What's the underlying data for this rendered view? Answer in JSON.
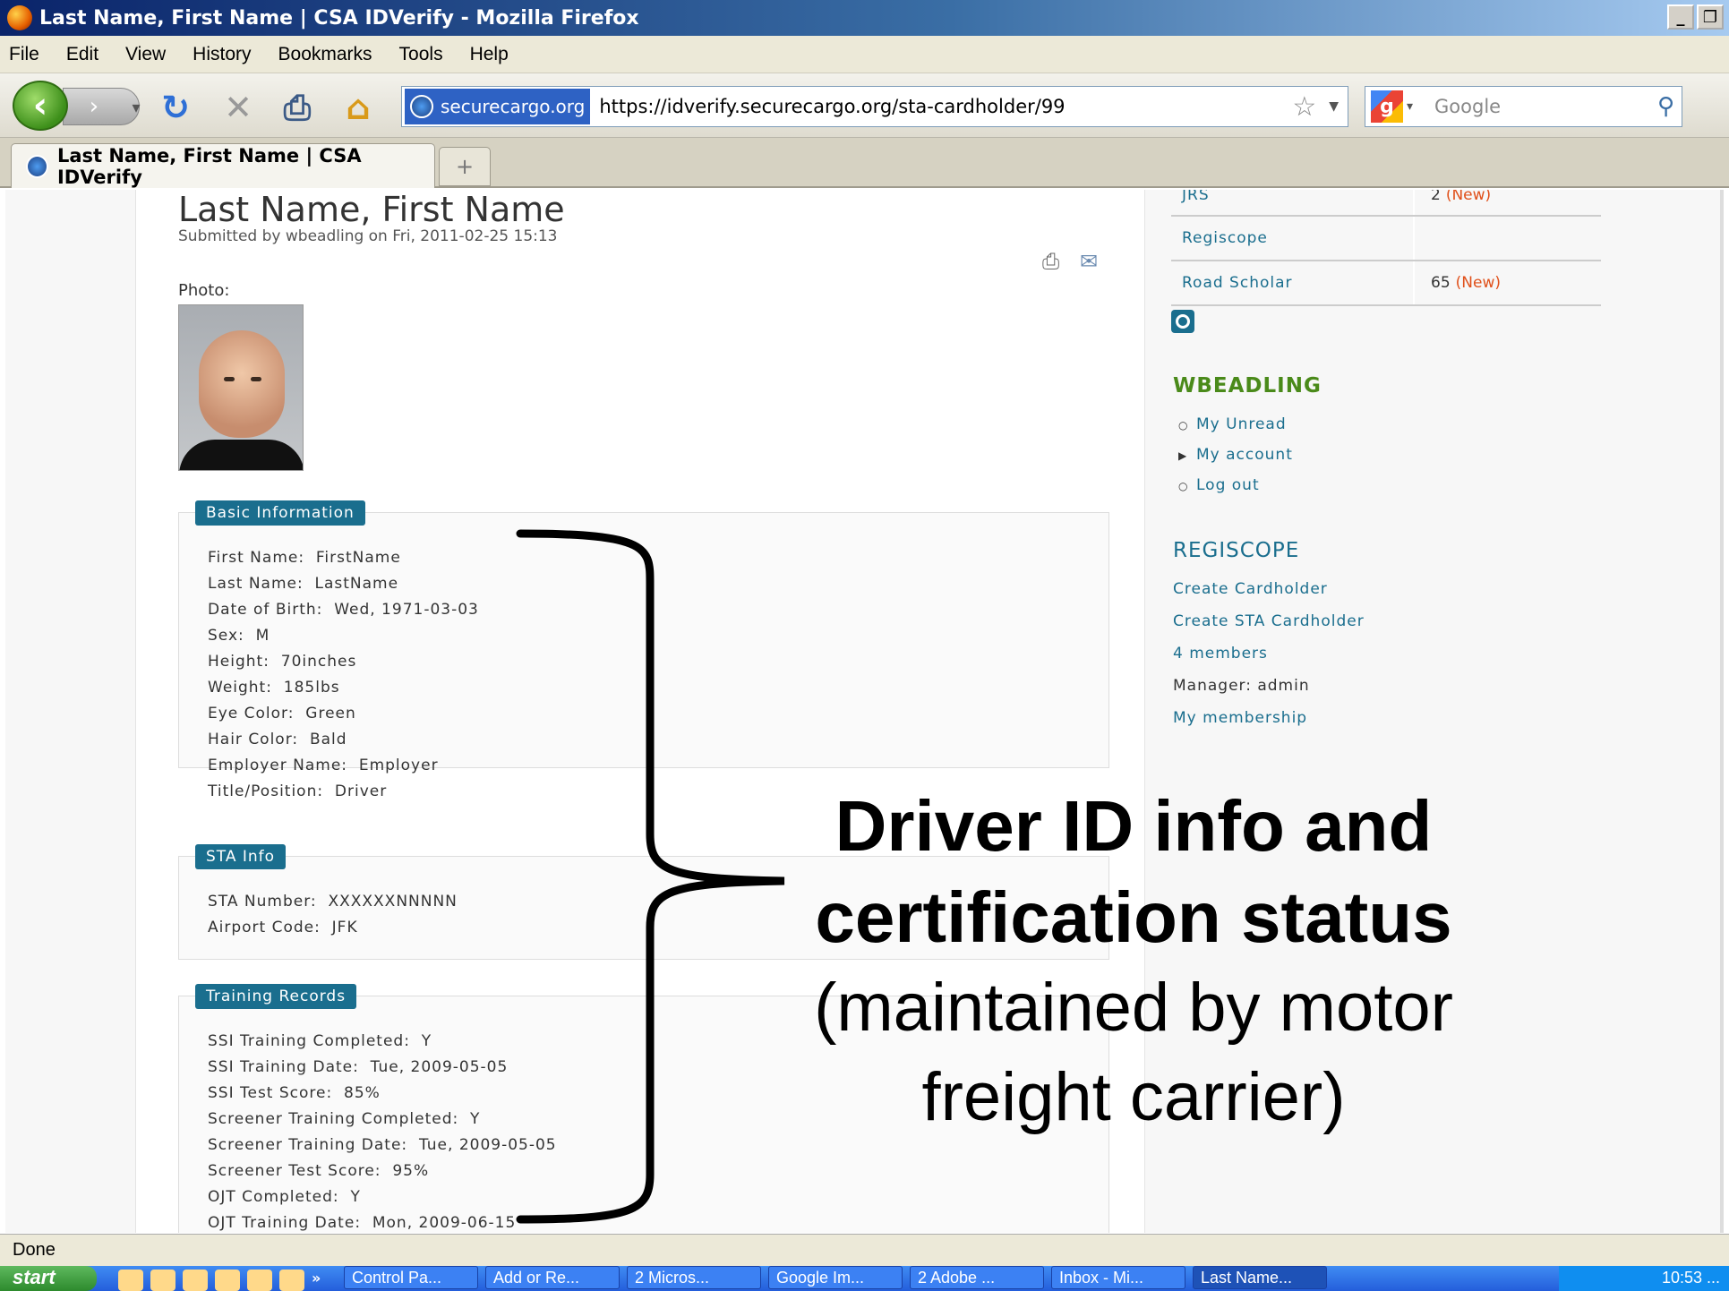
{
  "window": {
    "title": "Last Name, First Name | CSA IDVerify - Mozilla Firefox"
  },
  "menu": [
    "File",
    "Edit",
    "View",
    "History",
    "Bookmarks",
    "Tools",
    "Help"
  ],
  "navbar": {
    "site_badge": "securecargo.org",
    "url": "https://idverify.securecargo.org/sta-cardholder/99",
    "search_placeholder": "Google"
  },
  "tab": {
    "label": "Last Name, First Name | CSA IDVerify",
    "new_tab": "+"
  },
  "page": {
    "title": "Last Name, First Name",
    "submitted": "Submitted by wbeadling on Fri, 2011-02-25 15:13",
    "photo_label": "Photo:",
    "basic_info": {
      "legend": "Basic Information",
      "rows": [
        {
          "label": "First Name",
          "value": "FirstName"
        },
        {
          "label": "Last Name",
          "value": "LastName"
        },
        {
          "label": "Date of Birth",
          "value": "Wed, 1971-03-03"
        },
        {
          "label": "Sex",
          "value": "M"
        },
        {
          "label": "Height",
          "value": "70inches"
        },
        {
          "label": "Weight",
          "value": "185lbs"
        },
        {
          "label": "Eye Color",
          "value": "Green"
        },
        {
          "label": "Hair Color",
          "value": "Bald"
        },
        {
          "label": "Employer Name",
          "value": "Employer"
        },
        {
          "label": "Title/Position",
          "value": "Driver"
        }
      ]
    },
    "sta_info": {
      "legend": "STA Info",
      "rows": [
        {
          "label": "STA Number",
          "value": "XXXXXXNNNNN"
        },
        {
          "label": "Airport Code",
          "value": "JFK"
        }
      ]
    },
    "training": {
      "legend": "Training Records",
      "rows": [
        {
          "label": "SSI Training Completed",
          "value": "Y"
        },
        {
          "label": "SSI Training Date",
          "value": "Tue, 2009-05-05"
        },
        {
          "label": "SSI Test Score",
          "value": "85%"
        },
        {
          "label": "Screener Training Completed",
          "value": "Y"
        },
        {
          "label": "Screener Training Date",
          "value": "Tue, 2009-05-05"
        },
        {
          "label": "Screener Test Score",
          "value": "95%"
        },
        {
          "label": "OJT Completed",
          "value": "Y"
        },
        {
          "label": "OJT Training Date",
          "value": "Mon, 2009-06-15"
        }
      ]
    }
  },
  "sidebar": {
    "groups_table": [
      {
        "name": "JRS",
        "count": "2",
        "new": "(New)"
      },
      {
        "name": "Regiscope",
        "count": "",
        "new": ""
      },
      {
        "name": "Road Scholar",
        "count": "65",
        "new": "(New)"
      }
    ],
    "user_block": {
      "title": "WBEADLING",
      "items": [
        "My Unread",
        "My account",
        "Log out"
      ]
    },
    "regiscope_block": {
      "title": "REGISCOPE",
      "links": [
        "Create Cardholder",
        "Create STA Cardholder",
        "4 members"
      ],
      "manager": "Manager: admin",
      "membership": "My membership"
    }
  },
  "annotation": {
    "bold_line1": "Driver ID info and",
    "bold_line2": "certification status",
    "normal_line1": "(maintained by motor",
    "normal_line2": "freight carrier)"
  },
  "status": "Done",
  "taskbar": {
    "start": "start",
    "more": "»",
    "tasks": [
      "Control Pa...",
      "Add or Re...",
      "2 Micros...",
      "Google Im...",
      "2 Adobe ...",
      "Inbox - Mi...",
      "Last Name..."
    ],
    "clock": "10:53 ..."
  }
}
